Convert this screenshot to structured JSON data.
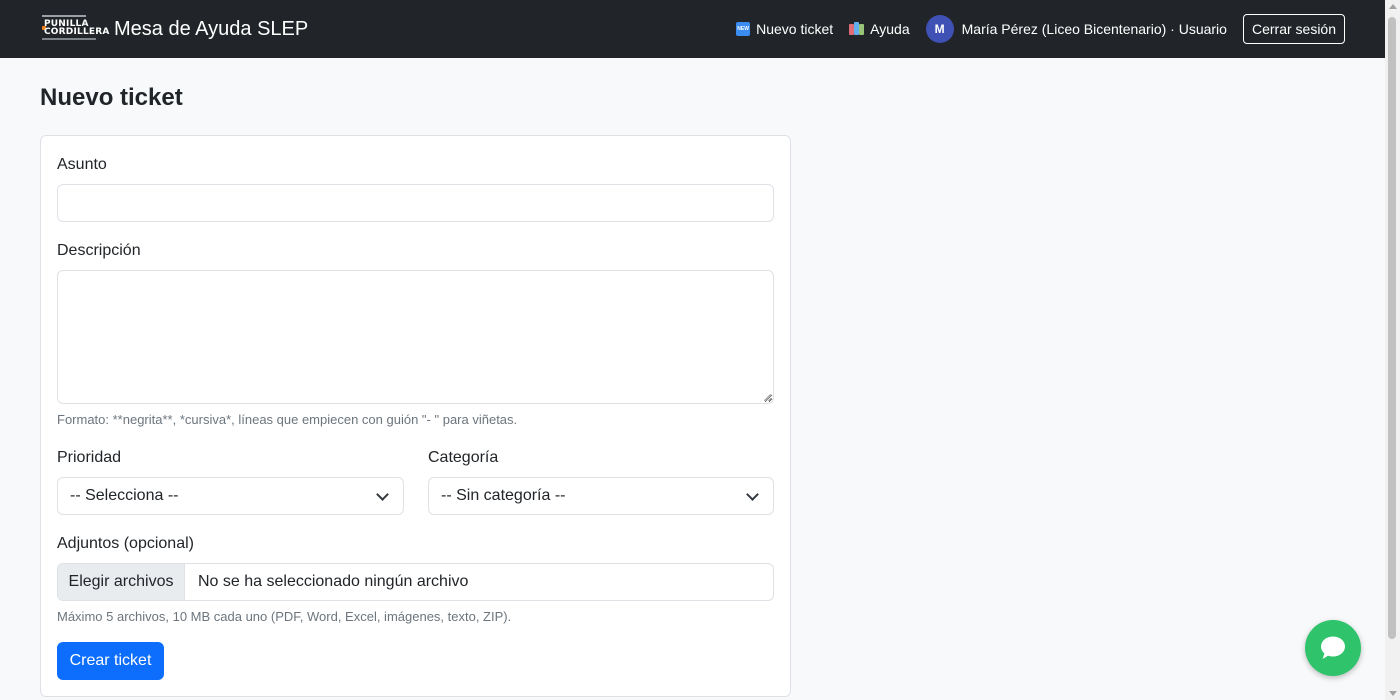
{
  "navbar": {
    "logo_line1": "PUNILLA",
    "logo_line2": "CORDILLERA",
    "title": "Mesa de Ayuda SLEP",
    "links": [
      {
        "label": "Nuevo ticket",
        "icon": "new-emoji-icon"
      },
      {
        "label": "Ayuda",
        "icon": "books-emoji-icon"
      }
    ],
    "avatar_initial": "M",
    "user_label": "María Pérez (Liceo Bicentenario) · Usuario",
    "logout_label": "Cerrar sesión"
  },
  "page": {
    "title": "Nuevo ticket"
  },
  "form": {
    "subject_label": "Asunto",
    "subject_value": "",
    "description_label": "Descripción",
    "description_value": "",
    "format_help": "Formato: **negrita**, *cursiva*, líneas que empiecen con guión \"- \" para viñetas.",
    "priority_label": "Prioridad",
    "priority_selected": "-- Selecciona --",
    "category_label": "Categoría",
    "category_selected": "-- Sin categoría --",
    "attachments_label": "Adjuntos (opcional)",
    "file_button_label": "Elegir archivos",
    "file_status": "No se ha seleccionado ningún archivo",
    "attachments_help": "Máximo 5 archivos, 10 MB cada uno (PDF, Word, Excel, imágenes, texto, ZIP).",
    "submit_label": "Crear ticket"
  },
  "colors": {
    "navbar_bg": "#212529",
    "primary": "#0d6efd",
    "chat_fab": "#2fc36b",
    "avatar": "#3f51b5"
  },
  "icons": {
    "chat_fab": "chat-bubble-icon",
    "select_arrow": "chevron-down-icon"
  }
}
